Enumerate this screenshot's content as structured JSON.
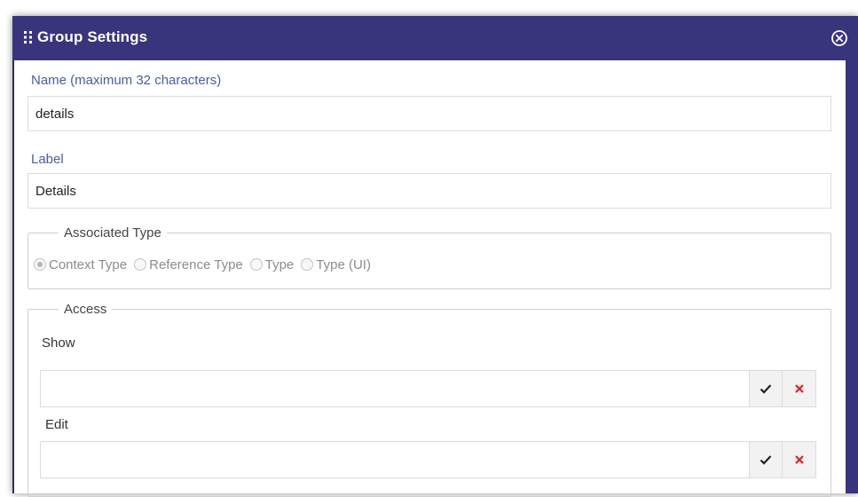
{
  "dialog": {
    "title": "Group Settings",
    "close_icon": "close-circle-icon",
    "grip_icon": "drag-handle-icon"
  },
  "name_field": {
    "label": "Name (maximum 32 characters)",
    "value": "details"
  },
  "label_field": {
    "label": "Label",
    "value": "Details"
  },
  "associated_type": {
    "legend": "Associated Type",
    "options": [
      {
        "label": "Context Type",
        "checked": true
      },
      {
        "label": "Reference Type",
        "checked": false
      },
      {
        "label": "Type",
        "checked": false
      },
      {
        "label": "Type (UI)",
        "checked": false
      }
    ]
  },
  "access": {
    "legend": "Access",
    "show": {
      "label": "Show",
      "value": "",
      "confirm_icon": "check-icon",
      "clear_icon": "x-icon"
    },
    "edit": {
      "label": "Edit",
      "value": "",
      "confirm_icon": "check-icon",
      "clear_icon": "x-icon"
    }
  },
  "colors": {
    "titlebar": "#38357d",
    "label_blue": "#4b5da0",
    "clear_red": "#e02020"
  }
}
